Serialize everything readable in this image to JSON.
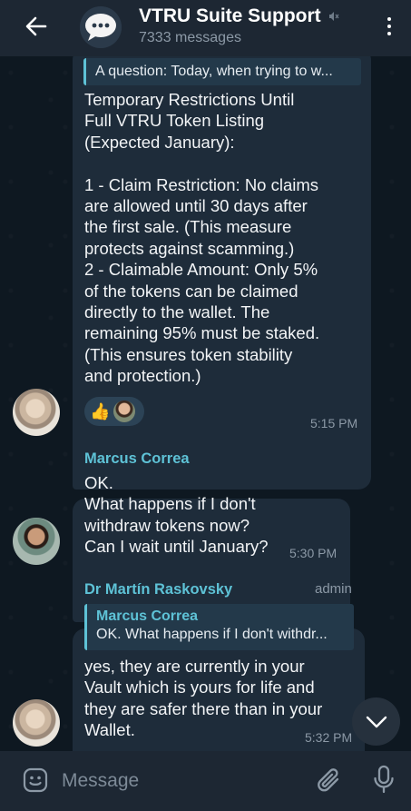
{
  "header": {
    "title": "VTRU Suite Support",
    "subtitle": "7333 messages",
    "back_icon": "arrow-left-icon",
    "mute_icon": "muted-speaker-icon",
    "more_icon": "more-vertical-icon"
  },
  "messages": [
    {
      "reply_preview": "A question: Today, when trying to w...",
      "text": "Temporary Restrictions Until\nFull VTRU Token Listing\n(Expected January):\n\n1 - Claim Restriction: No claims\nare allowed until 30 days after\nthe first sale. (This measure\nprotects against scamming.)\n2 - Claimable Amount: Only 5%\nof the tokens can be claimed\ndirectly to the wallet. The\nremaining 95% must be staked.\n(This ensures token stability\nand protection.)",
      "reaction_emoji": "👍",
      "time": "5:15 PM"
    },
    {
      "sender": "Marcus Correa",
      "text": "OK.\nWhat happens if I don't\nwithdraw tokens now?\nCan I wait until January?",
      "time": "5:30 PM"
    },
    {
      "sender": "Dr Martín Raskovsky",
      "role": "admin",
      "reply_name": "Marcus Correa",
      "reply_preview": "OK.  What happens if I don't withdr...",
      "text": "yes, they are currently in your\nVault which is yours for life and\nthey are safer there than in your\nWallet.",
      "time": "5:32 PM"
    }
  ],
  "input": {
    "placeholder": "Message"
  },
  "colors": {
    "accent": "#5ec2d6",
    "bubble": "#1e2c3a",
    "header": "#1d2733",
    "background": "#0e1821"
  }
}
